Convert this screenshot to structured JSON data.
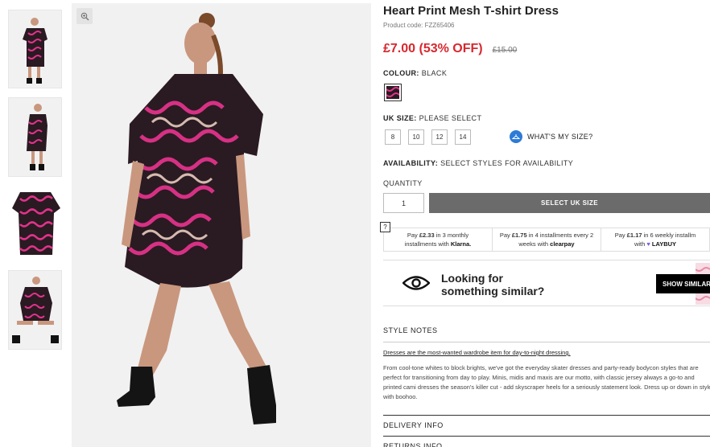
{
  "product": {
    "title": "Heart Print Mesh T-shirt Dress",
    "product_code": "Product code: FZZ65406",
    "price_now": "£7.00 (53% OFF)",
    "price_was": "£15.00"
  },
  "colour": {
    "label": "COLOUR:",
    "value": "BLACK"
  },
  "size": {
    "label": "UK SIZE:",
    "value": "PLEASE SELECT",
    "options": [
      "8",
      "10",
      "12",
      "14"
    ],
    "whats_my_size": "WHAT'S MY SIZE?"
  },
  "availability": {
    "label": "AVAILABILITY:",
    "value": "SELECT STYLES FOR AVAILABILITY"
  },
  "quantity": {
    "label": "QUANTITY",
    "value": "1"
  },
  "cta": {
    "select_size": "SELECT UK SIZE"
  },
  "payments": {
    "help": "?",
    "klarna": {
      "line1_a": "Pay ",
      "amount": "£2.33",
      "line1_b": " in 3 monthly",
      "line2": "installments with ",
      "brand": "Klarna."
    },
    "clearpay": {
      "line1_a": "Pay ",
      "amount": "£1.75",
      "line1_b": " in 4 installments every 2",
      "line2": "weeks with ",
      "brand": "clearpay"
    },
    "laybuy": {
      "line1_a": "Pay ",
      "amount": "£1.17",
      "line1_b": " in 6 weekly installm",
      "line2": "with ",
      "brand": "LAYBUY"
    }
  },
  "similar": {
    "line1": "Looking for",
    "line2": "something similar?",
    "button": "SHOW SIMILAR"
  },
  "style_notes": {
    "heading": "STYLE NOTES",
    "lead": "Dresses are the most-wanted wardrobe item for day-to-night dressing.",
    "body": "From cool-tone whites to block brights, we've got the everyday skater dresses and party-ready bodycon styles that are perfect for transitioning from day to play. Minis, midis and maxis are our motto, with classic jersey always a go-to and printed cami dresses the season's killer cut - add skyscraper heels for a seriously statement look. Dress up or down in style with boohoo."
  },
  "accordions": {
    "delivery": "DELIVERY INFO",
    "returns": "RETURNS INFO"
  },
  "colors": {
    "sale_red": "#d7282f",
    "cta_grey": "#6b6b6b",
    "dress_pink": "#e0338a",
    "dress_black": "#2a1a22"
  }
}
